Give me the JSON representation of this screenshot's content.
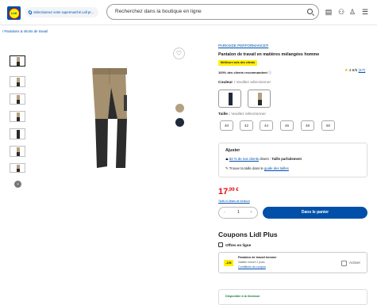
{
  "header": {
    "logo_text": "Lidl",
    "store_selector": "Sélectionnez votre supermarché Lidl pr...",
    "search_placeholder": "Recherchez dans la boutique en ligne"
  },
  "breadcrumb": "/ Pantalons & shorts de travail",
  "product": {
    "brand": "PARKSIDE PERFORMANCE®",
    "title": "Pantalon de travail en matières mélangées homme",
    "badge": "Meilleure avis des clients",
    "recommend": "100% des clients recommandent",
    "rating": "4.9/5",
    "reviews": "(17)",
    "color_label": "Couleur :",
    "color_hint": "Veuillez sélectionner",
    "size_label": "Taille :",
    "size_hint": "Veuillez sélectionner",
    "sizes": [
      "40",
      "42",
      "44",
      "46",
      "48",
      "50"
    ],
    "colors": [
      "#1f2a3a",
      "#b3a080"
    ]
  },
  "fit_box": {
    "title": "Ajuster",
    "row1_link": "82 % de nos clients",
    "row1_text": "disent :",
    "row1_bold": "Taille parfaitement",
    "row2_text": "Trouve ta taille dans le",
    "row2_link": "guide des tailles"
  },
  "price": {
    "main": "17",
    "cents": ",99 €",
    "shipping_link": "Tarifs et délais de livraison"
  },
  "quantity": {
    "minus": "−",
    "value": "1",
    "plus": "+"
  },
  "cart_button": "Dans le panier",
  "coupons": {
    "heading": "Coupons Lidl Plus",
    "online_label": "Offres en ligne",
    "discount": "-10€",
    "name": "Pantalon de travail homme",
    "validity": "Valable encore 2 jours",
    "conditions": "Conditions du coupon",
    "activate": "Activer"
  },
  "availability": "Disponible à la livraison"
}
